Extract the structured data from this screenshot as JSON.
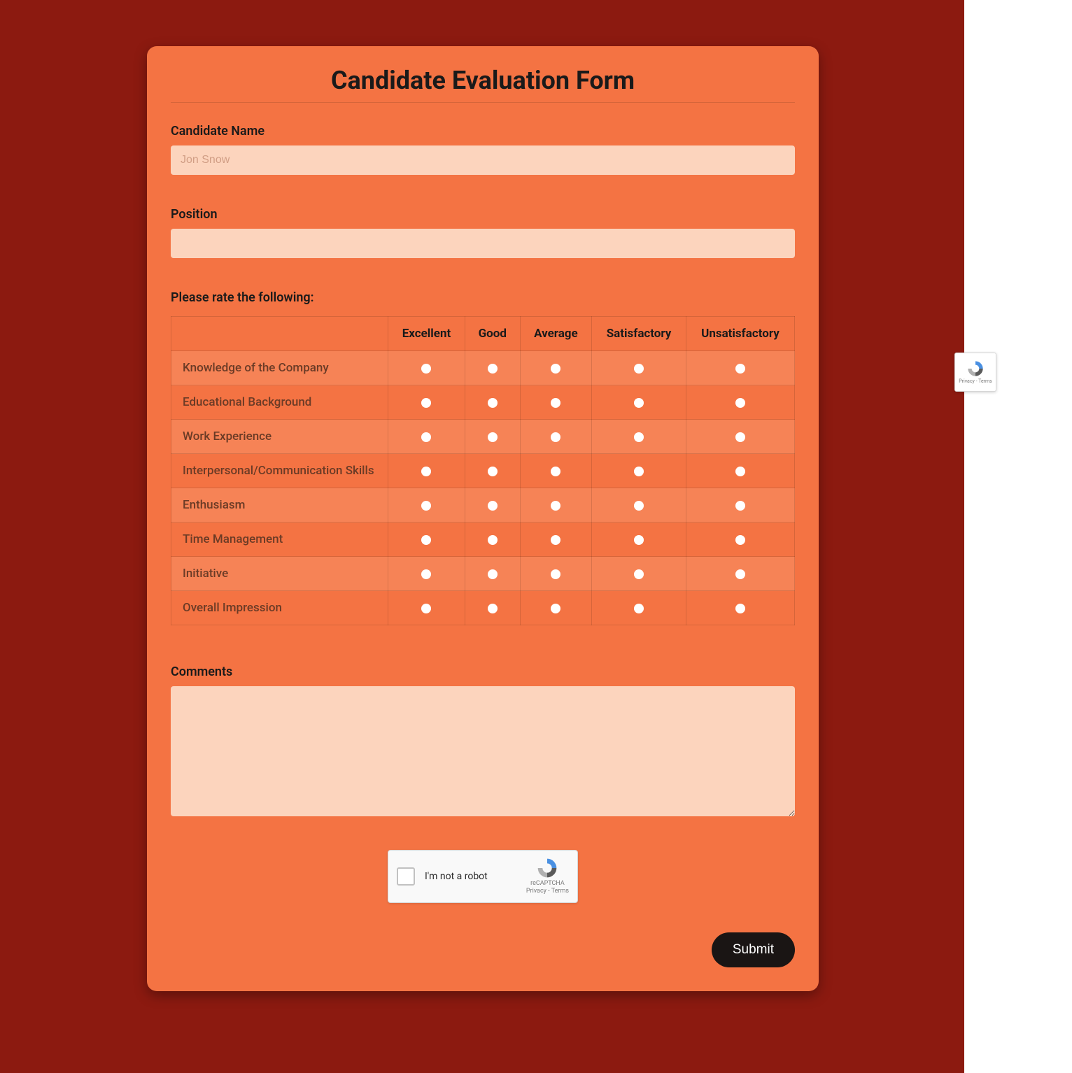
{
  "form": {
    "title": "Candidate Evaluation Form",
    "candidate_name": {
      "label": "Candidate Name",
      "placeholder": "Jon Snow",
      "value": ""
    },
    "position": {
      "label": "Position",
      "placeholder": "",
      "value": ""
    },
    "rating_section": {
      "prompt": "Please rate the following:",
      "columns": [
        "Excellent",
        "Good",
        "Average",
        "Satisfactory",
        "Unsatisfactory"
      ],
      "rows": [
        "Knowledge of the Company",
        "Educational Background",
        "Work Experience",
        "Interpersonal/Communication Skills",
        "Enthusiasm",
        "Time Management",
        "Initiative",
        "Overall Impression"
      ]
    },
    "comments": {
      "label": "Comments",
      "value": ""
    },
    "captcha": {
      "label": "I'm not a robot",
      "brand": "reCAPTCHA",
      "legal": "Privacy - Terms"
    },
    "submit_label": "Submit"
  }
}
